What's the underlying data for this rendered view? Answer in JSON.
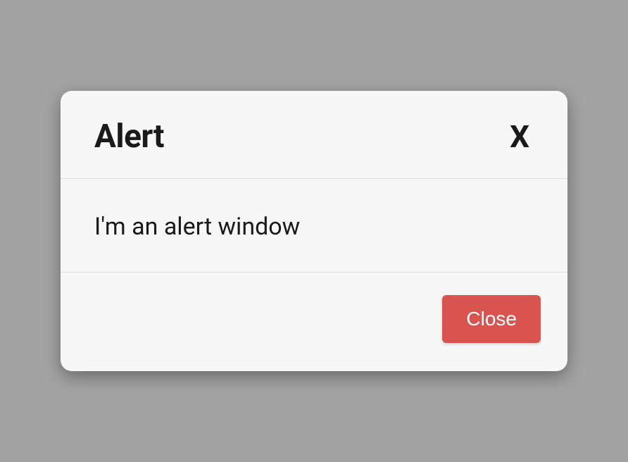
{
  "dialog": {
    "title": "Alert",
    "close_icon": "X",
    "message": "I'm an alert window",
    "close_button_label": "Close"
  },
  "colors": {
    "background": "#a3a3a3",
    "dialog_bg": "#f7f7f7",
    "border": "#dedede",
    "text": "#1a1a1a",
    "button_bg": "#d9534f",
    "button_text": "#ffffff"
  }
}
